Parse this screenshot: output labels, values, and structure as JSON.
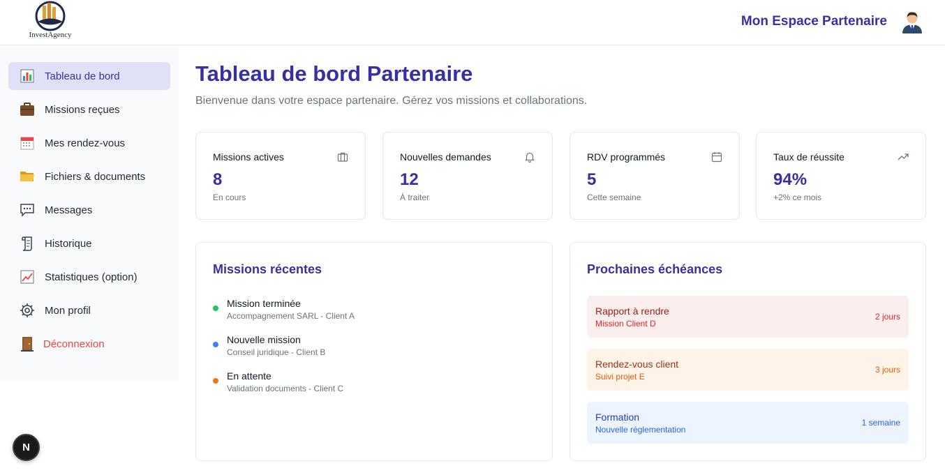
{
  "header": {
    "logo_text": "InvestAgency",
    "title": "Mon Espace Partenaire",
    "avatar_icon": "user-avatar-icon"
  },
  "sidebar": {
    "items": [
      {
        "label": "Tableau de bord",
        "icon": "chart-icon",
        "active": true
      },
      {
        "label": "Missions reçues",
        "icon": "briefcase-icon"
      },
      {
        "label": "Mes rendez-vous",
        "icon": "calendar-icon"
      },
      {
        "label": "Fichiers & documents",
        "icon": "folder-icon"
      },
      {
        "label": "Messages",
        "icon": "chat-icon"
      },
      {
        "label": "Historique",
        "icon": "scroll-icon"
      },
      {
        "label": "Statistiques (option)",
        "icon": "line-chart-icon"
      },
      {
        "label": "Mon profil",
        "icon": "gear-icon"
      },
      {
        "label": "Déconnexion",
        "icon": "door-icon"
      }
    ]
  },
  "main": {
    "title": "Tableau de bord Partenaire",
    "subtitle": "Bienvenue dans votre espace partenaire. Gérez vos missions et collaborations."
  },
  "stats": [
    {
      "label": "Missions actives",
      "value": "8",
      "caption": "En cours",
      "icon": "briefcase-outline-icon"
    },
    {
      "label": "Nouvelles demandes",
      "value": "12",
      "caption": "À traiter",
      "icon": "bell-icon"
    },
    {
      "label": "RDV programmés",
      "value": "5",
      "caption": "Cette semaine",
      "icon": "calendar-outline-icon"
    },
    {
      "label": "Taux de réussite",
      "value": "94%",
      "caption": "+2% ce mois",
      "icon": "trending-up-icon"
    }
  ],
  "missions": {
    "title": "Missions récentes",
    "items": [
      {
        "title": "Mission terminée",
        "subtitle": "Accompagnement SARL - Client A",
        "color": "#22c55e"
      },
      {
        "title": "Nouvelle mission",
        "subtitle": "Conseil juridique - Client B",
        "color": "#3b82f6"
      },
      {
        "title": "En attente",
        "subtitle": "Validation documents - Client C",
        "color": "#f97316"
      }
    ]
  },
  "deadlines": {
    "title": "Prochaines échéances",
    "items": [
      {
        "title": "Rapport à rendre",
        "subtitle": "Mission Client D",
        "time": "2 jours",
        "bg": "#fdeeee",
        "fg": "#991b1b",
        "sub_fg": "#dc2626"
      },
      {
        "title": "Rendez-vous client",
        "subtitle": "Suivi projet E",
        "time": "3 jours",
        "bg": "#fef3e8",
        "fg": "#9a3412",
        "sub_fg": "#ea580c"
      },
      {
        "title": "Formation",
        "subtitle": "Nouvelle réglementation",
        "time": "1 semaine",
        "bg": "#eef4ff",
        "fg": "#1e40af",
        "sub_fg": "#2563eb"
      }
    ]
  },
  "badge": {
    "label": "N"
  },
  "colors": {
    "accent": "#3730a3",
    "muted": "#6b7280",
    "danger": "#ef4444"
  }
}
